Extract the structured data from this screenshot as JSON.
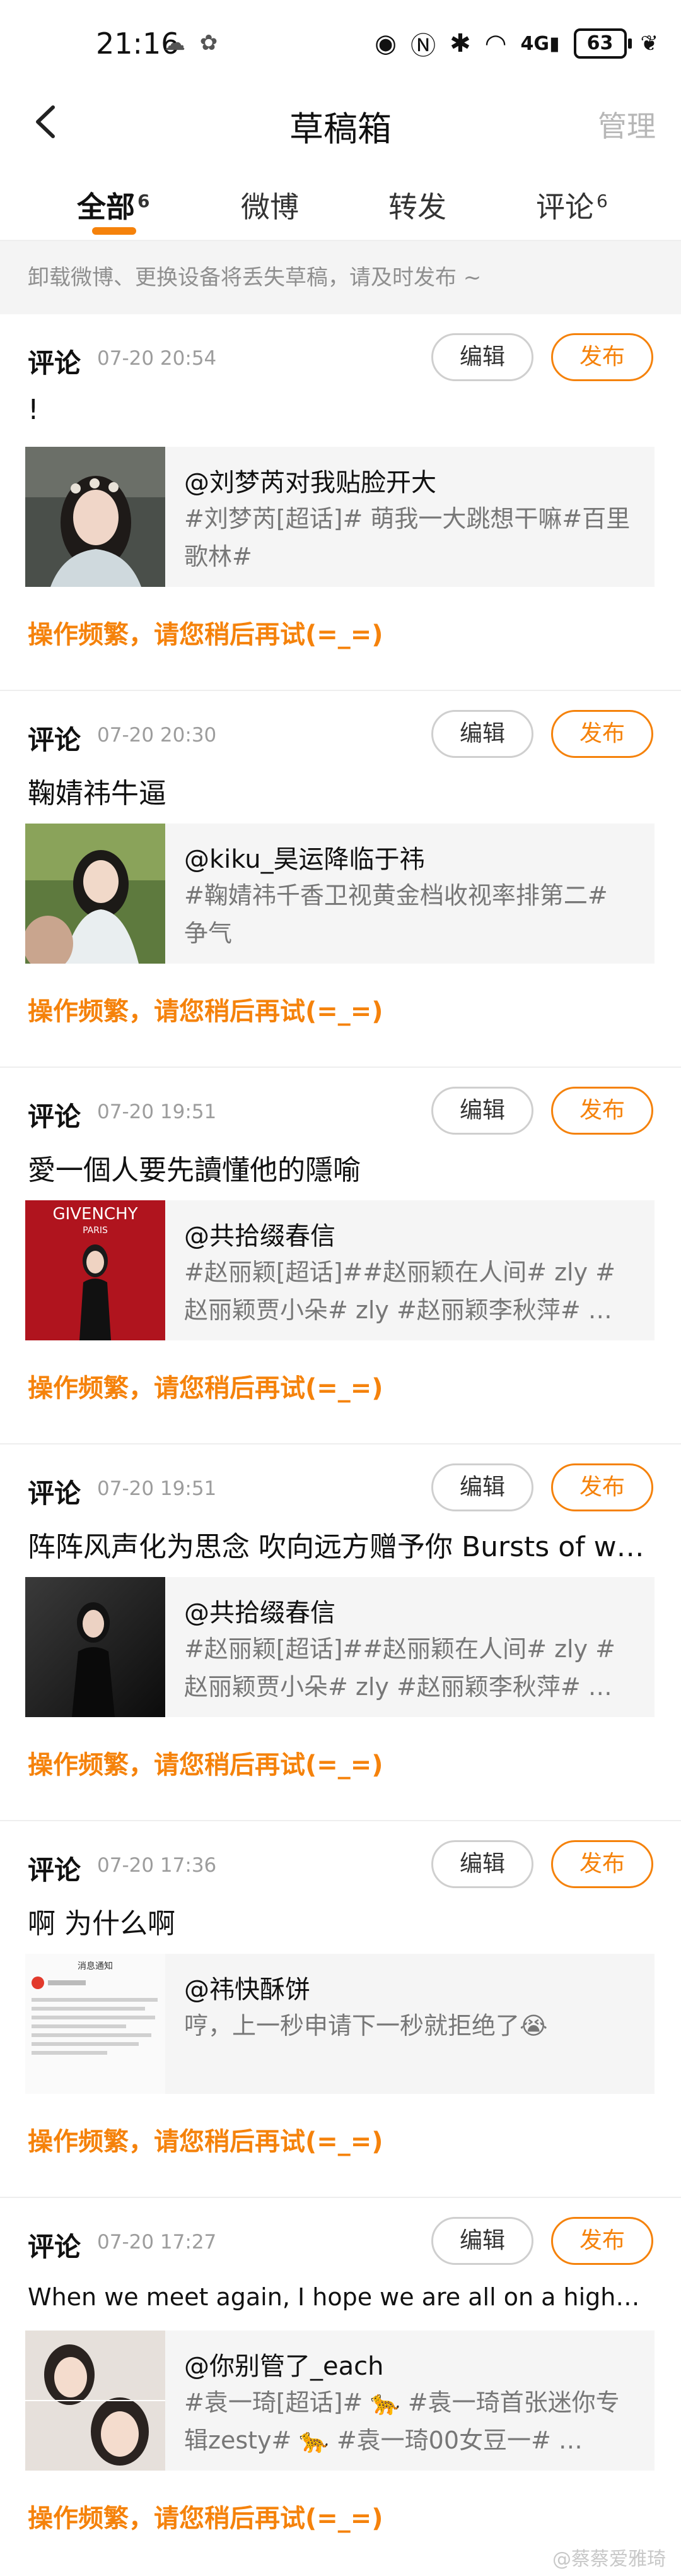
{
  "status_bar": {
    "time": "21:16",
    "network": "4G",
    "battery": "63"
  },
  "header": {
    "title": "草稿箱",
    "manage_label": "管理"
  },
  "tabs": [
    {
      "label": "全部",
      "count": "6"
    },
    {
      "label": "微博",
      "count": ""
    },
    {
      "label": "转发",
      "count": ""
    },
    {
      "label": "评论",
      "count": "6"
    }
  ],
  "notice": "卸载微博、更换设备将丢失草稿，请及时发布 ~",
  "edit_label": "编辑",
  "publish_label": "发布",
  "drafts": [
    {
      "type": "评论",
      "time": "07-20 20:54",
      "text": "!",
      "card_user": "@刘梦芮对我贴脸开大",
      "card_desc": "#刘梦芮[超话]# 萌我一大跳想干嘛#百里歌林#",
      "error": "操作频繁，请您稍后再试(=_=)"
    },
    {
      "type": "评论",
      "time": "07-20 20:30",
      "text": "鞠婧祎牛逼",
      "card_user": "@kiku_昊运降临于祎",
      "card_desc": "#鞠婧祎千香卫视黄金档收视率排第二# 争气",
      "error": "操作频繁，请您稍后再试(=_=)"
    },
    {
      "type": "评论",
      "time": "07-20 19:51",
      "text": "愛一個人要先讀懂他的隱喻",
      "card_user": "@共拾缀春信",
      "card_desc": "#赵丽颖[超话]##赵丽颖在人间# zly # 赵丽颖贾小朵# zly #赵丽颖李秋萍# …",
      "error": "操作频繁，请您稍后再试(=_=)"
    },
    {
      "type": "评论",
      "time": "07-20 19:51",
      "text": "阵阵风声化为思念 吹向远方赠予你 Bursts of wo t…",
      "card_user": "@共拾缀春信",
      "card_desc": "#赵丽颖[超话]##赵丽颖在人间# zly # 赵丽颖贾小朵# zly #赵丽颖李秋萍# …",
      "error": "操作频繁，请您稍后再试(=_=)"
    },
    {
      "type": "评论",
      "time": "07-20 17:36",
      "text": "啊 为什么啊",
      "card_user": "@祎快酥饼",
      "card_desc": "哼，上一秒申请下一秒就拒绝了😭",
      "error": "操作频繁，请您稍后再试(=_=)"
    },
    {
      "type": "评论",
      "time": "07-20 17:27",
      "text": "When we meet again, I hope we are all on a higher ground. 再 …",
      "card_user": "@你别管了_each",
      "card_desc": "#袁一琦[超话]# 🐆 #袁一琦首张迷你专辑zesty# 🐆 #袁一琦00女豆一# …",
      "error": "操作频繁，请您稍后再试(=_=)"
    }
  ],
  "thumb_texts": {
    "brand": "GIVENCHY",
    "city": "PARIS",
    "notice_title": "消息通知"
  },
  "watermark": "@蔡蔡爱雅琦"
}
